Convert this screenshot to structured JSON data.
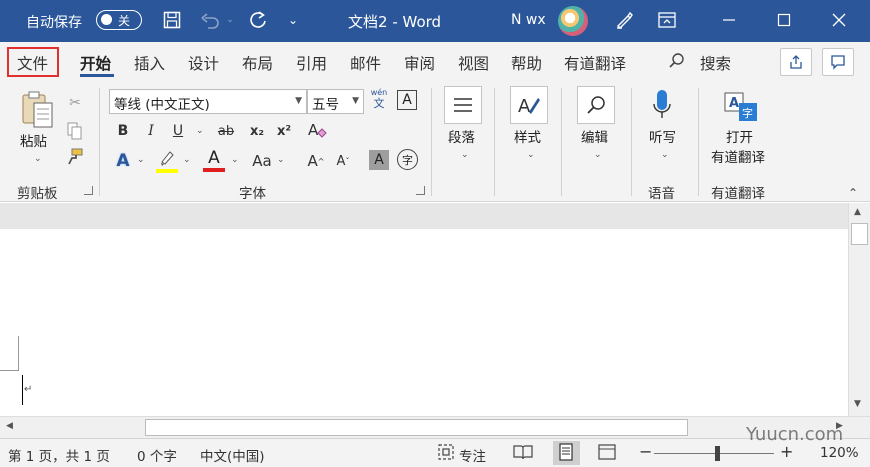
{
  "titlebar": {
    "autosave_label": "自动保存",
    "toggle_state": "关",
    "doc_title": "文档2",
    "app_name": "Word",
    "user_name": "N wx",
    "separator": " - "
  },
  "tabs": [
    {
      "label": "文件"
    },
    {
      "label": "开始"
    },
    {
      "label": "插入"
    },
    {
      "label": "设计"
    },
    {
      "label": "布局"
    },
    {
      "label": "引用"
    },
    {
      "label": "邮件"
    },
    {
      "label": "审阅"
    },
    {
      "label": "视图"
    },
    {
      "label": "帮助"
    },
    {
      "label": "有道翻译"
    }
  ],
  "search": {
    "label": "搜索"
  },
  "clipboard": {
    "paste_label": "粘贴",
    "group_label": "剪贴板"
  },
  "font": {
    "font_name": "等线 (中文正文)",
    "font_size": "五号",
    "group_label": "字体",
    "wen": "wén",
    "wen_char": "文",
    "bold": "B",
    "italic": "I",
    "underline": "U",
    "strike": "ab",
    "sub": "x₂",
    "sup": "x²",
    "text_effect": "A",
    "highlight": "ab",
    "font_color": "A",
    "change_case": "Aa",
    "grow": "A",
    "shrink": "A",
    "char_shade": "A",
    "enclose": "字"
  },
  "paragraph": {
    "label": "段落"
  },
  "styles": {
    "label": "样式"
  },
  "editing": {
    "label": "编辑"
  },
  "voice": {
    "dictate_label": "听写",
    "group_label": "语音"
  },
  "youdao": {
    "open_line1": "打开",
    "open_line2": "有道翻译",
    "group_label": "有道翻译"
  },
  "status": {
    "page": "第 1 页，共 1 页",
    "words": "0 个字",
    "language": "中文(中国)",
    "focus": "专注",
    "zoom": "120%"
  },
  "watermark": "Yuucn.com",
  "colors": {
    "title_bg": "#2b579a",
    "highlight_yellow": "#ffff00",
    "font_red": "#e02020",
    "file_box": "#e03030"
  }
}
